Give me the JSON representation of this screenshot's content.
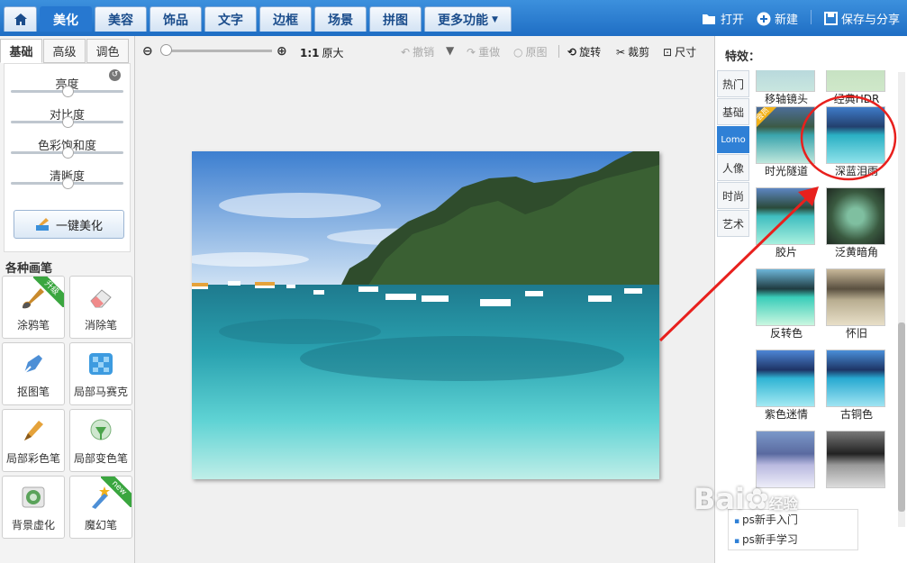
{
  "nav": {
    "tabs": [
      "美化",
      "美容",
      "饰品",
      "文字",
      "边框",
      "场景",
      "拼图",
      "更多功能"
    ],
    "active": "美化",
    "open_label": "打开",
    "new_label": "新建",
    "save_label": "保存与分享"
  },
  "left": {
    "subtabs": [
      "基础",
      "高级",
      "调色"
    ],
    "sliders": [
      {
        "label": "亮度",
        "level": 0.5
      },
      {
        "label": "对比度",
        "level": 0.5
      },
      {
        "label": "色彩饱和度",
        "level": 0.5
      },
      {
        "label": "清晰度",
        "level": 0.5
      }
    ],
    "one_key_label": "一键美化",
    "brushes_title": "各种画笔",
    "brushes": [
      {
        "label": "涂鸦笔",
        "badge": "升级"
      },
      {
        "label": "消除笔",
        "badge": ""
      },
      {
        "label": "抠图笔",
        "badge": ""
      },
      {
        "label": "局部马赛克",
        "badge": ""
      },
      {
        "label": "局部彩色笔",
        "badge": ""
      },
      {
        "label": "局部变色笔",
        "badge": ""
      },
      {
        "label": "背景虚化",
        "badge": ""
      },
      {
        "label": "魔幻笔",
        "badge": "new"
      }
    ]
  },
  "toolbar": {
    "ratio_label": "1:1",
    "original_size_label": "原大",
    "undo_label": "撤销",
    "redo_label": "重做",
    "original_label": "原图",
    "rotate_label": "旋转",
    "crop_label": "裁剪",
    "size_label": "尺寸"
  },
  "right": {
    "title": "特效：",
    "tabs": [
      "热门",
      "基础",
      "Lomo",
      "人像",
      "时尚",
      "艺术"
    ],
    "active_tab": "Lomo",
    "effects": [
      {
        "label": "移轴镜头"
      },
      {
        "label": "经典HDR"
      },
      {
        "label": "时光隧道",
        "vip": "会员"
      },
      {
        "label": "深蓝泪雨"
      },
      {
        "label": "胶片"
      },
      {
        "label": "泛黄暗角"
      },
      {
        "label": "反转色"
      },
      {
        "label": "怀旧"
      },
      {
        "label": "紫色迷情"
      },
      {
        "label": "古铜色"
      }
    ],
    "help_links": [
      "ps新手入门",
      "ps新手学习"
    ]
  },
  "watermark": {
    "text": "Bai",
    "suffix": "经验"
  }
}
